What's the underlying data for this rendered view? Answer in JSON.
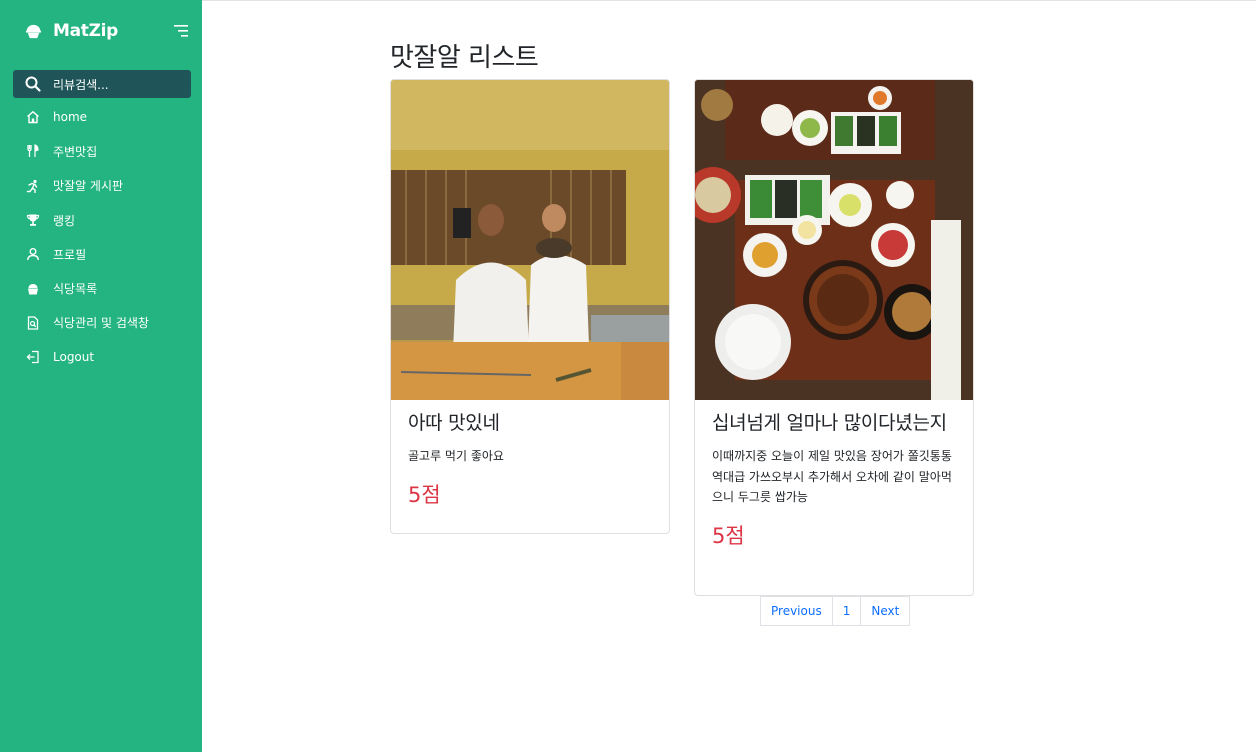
{
  "sidebar": {
    "brand": "MatZip",
    "search_placeholder": "리뷰검색...",
    "items": [
      {
        "label": "home",
        "icon": "home-icon"
      },
      {
        "label": "주변맛집",
        "icon": "utensils-icon"
      },
      {
        "label": "맛잘알 게시판",
        "icon": "running-icon"
      },
      {
        "label": "랭킹",
        "icon": "trophy-icon"
      },
      {
        "label": "프로필",
        "icon": "user-icon"
      },
      {
        "label": "식당목록",
        "icon": "rice-bowl-icon"
      },
      {
        "label": "식당관리 및 검색창",
        "icon": "document-search-icon"
      },
      {
        "label": "Logout",
        "icon": "logout-icon"
      }
    ],
    "colors": {
      "background": "#24b482",
      "search_bg": "#1f5558"
    }
  },
  "main": {
    "title": "맛잘알 리스트",
    "cards": [
      {
        "title": "아따 맛있네",
        "text": "골고루 먹기 좋아요",
        "score": "5점",
        "image": "photo of two chefs holding dishes in a restaurant kitchen"
      },
      {
        "title": "십녀넘게 얼마나 많이다녔는지",
        "text": "이때까지중 오늘이 제일 맛있음 장어가 쫄깃통통 역대급 가쓰오부시 추가해서 오차에 같이 말아먹으니 두그릇 쌉가능",
        "score": "5점",
        "image": "photo of a Korean/Japanese eel rice meal with many side dishes"
      }
    ],
    "pagination": {
      "previous": "Previous",
      "page": "1",
      "next": "Next"
    }
  },
  "colors": {
    "score": "#dc3545",
    "link": "#0d6efd"
  }
}
